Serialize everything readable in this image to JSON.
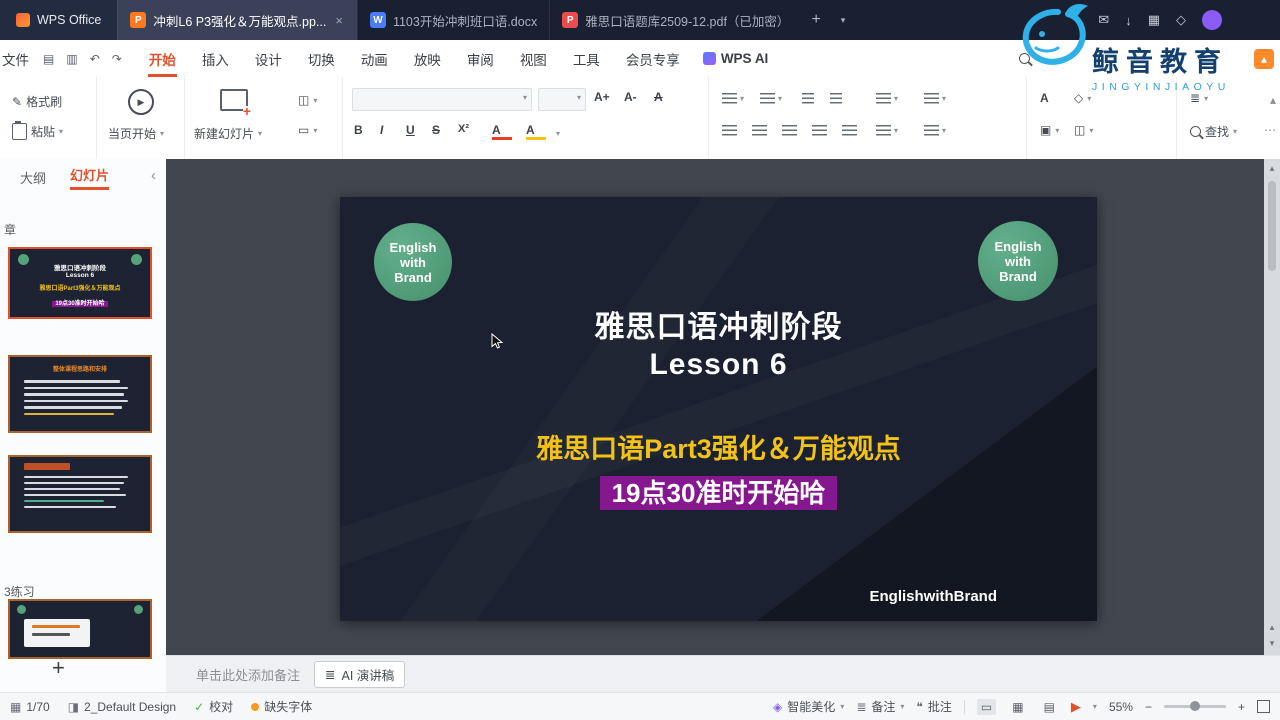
{
  "colors": {
    "accent": "#e2502c",
    "slide_bg": "#1b2130",
    "badge_green": "#55a27b",
    "title_yellow": "#f2c217",
    "highlight_purple": "#86188f",
    "ppt_icon": "#ff7a1e",
    "doc_icon": "#4a7cf6",
    "pdf_icon": "#e84c4c"
  },
  "icons": {
    "close": "×",
    "caret": "▾",
    "plus": "+",
    "collapse": "‹",
    "undo": "↶",
    "redo": "↷",
    "save": "▤",
    "print": "▥",
    "brush": "✎",
    "layout": "◫",
    "section_icon": "▭",
    "play": "▶",
    "check": "✓",
    "slides_icon": "▦",
    "design_icon": "◨",
    "mail": "✉",
    "download": "↓",
    "grid": "▦",
    "diamond": "◇",
    "view_normal": "▭",
    "view_sorter": "▦",
    "view_read": "▤",
    "minus": "−",
    "arrow_up": "▴",
    "arrow_down": "▾",
    "dots": "⋯",
    "bold": "B",
    "italic": "I",
    "underline": "U",
    "strike": "S",
    "sup": "X²",
    "font_color": "A",
    "font_bigger": "A+",
    "font_smaller": "A-",
    "clear_format": "A",
    "text_tool": "A",
    "shape_tool": "◇",
    "frame_tool": "▣",
    "lines": "≣",
    "beautify": "◈",
    "comment": "❝"
  },
  "titlebar": {
    "app": "WPS Office",
    "tabs": [
      {
        "badge": "P",
        "label": "冲刺L6 P3强化＆万能观点.pp..."
      },
      {
        "badge": "W",
        "label": "1103开始冲刺班口语.docx"
      },
      {
        "badge": "P",
        "label": "雅思口语题库2509-12.pdf（已加密）"
      }
    ]
  },
  "brand": {
    "name": "鲸音教育",
    "sub": "JINGYINJIAOYU"
  },
  "menubar": {
    "file": "文件",
    "items": [
      "开始",
      "插入",
      "设计",
      "切换",
      "动画",
      "放映",
      "审阅",
      "视图",
      "工具",
      "会员专享"
    ],
    "wps_ai": "WPS AI"
  },
  "ribbon": {
    "format_painter": "格式刷",
    "paste": "粘贴",
    "play_current": "当页开始",
    "new_slide": "新建幻灯片",
    "find": "查找"
  },
  "sidebar": {
    "tab_outline": "大纲",
    "tab_slides": "幻灯片",
    "section_top": "章",
    "section_practice": "3练习"
  },
  "slide": {
    "badge": [
      "English",
      "with",
      "Brand"
    ],
    "title": "雅思口语冲刺阶段",
    "subtitle": "Lesson 6",
    "line_yellow": "雅思口语Part3强化＆万能观点",
    "line_highlight": "19点30准时开始哈",
    "footer": "EnglishwithBrand"
  },
  "thumb2": {
    "title": "整体课程思路和安排"
  },
  "notes": {
    "placeholder": "单击此处添加备注",
    "ai_button": "AI 演讲稿"
  },
  "statusbar": {
    "page": "1/70",
    "design": "2_Default Design",
    "proof": "校对",
    "missing_font": "缺失字体",
    "beautify": "智能美化",
    "note": "备注",
    "comment": "批注",
    "zoom": "55%"
  }
}
